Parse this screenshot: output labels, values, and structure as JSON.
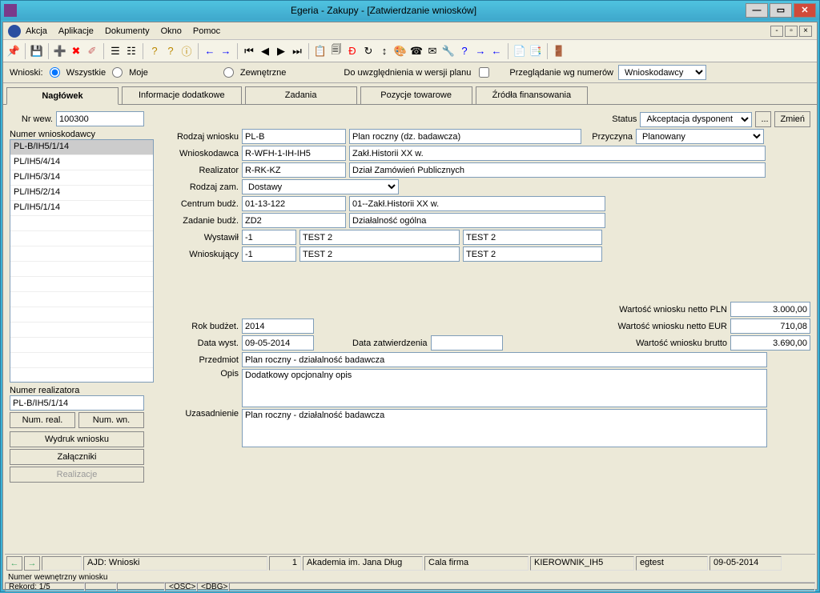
{
  "window": {
    "title": "Egeria - Zakupy - [Zatwierdzanie wniosków]"
  },
  "menu": {
    "m1": "Akcja",
    "m2": "Aplikacje",
    "m3": "Dokumenty",
    "m4": "Okno",
    "m5": "Pomoc"
  },
  "filter": {
    "label": "Wnioski:",
    "r1": "Wszystkie",
    "r2": "Moje",
    "r3": "Zewnętrzne",
    "chk": "Do uwzględnienia w wersji planu",
    "lbl2": "Przeglądanie wg numerów",
    "sel": "Wnioskodawcy"
  },
  "tabs": {
    "t1": "Nagłówek",
    "t2": "Informacje dodatkowe",
    "t3": "Zadania",
    "t4": "Pozycje towarowe",
    "t5": "Źródła finansowania"
  },
  "left": {
    "nr_label": "Nr wew.",
    "nr_val": "100300",
    "list1_label": "Numer wnioskodawcy",
    "list1": [
      "PL-B/IH5/1/14",
      "PL/IH5/4/14",
      "PL/IH5/3/14",
      "PL/IH5/2/14",
      "PL/IH5/1/14"
    ],
    "list2_label": "Numer realizatora",
    "list2_val": "PL-B/IH5/1/14",
    "b1": "Num. real.",
    "b2": "Num. wn.",
    "b3": "Wydruk wniosku",
    "b4": "Załączniki",
    "b5": "Realizacje"
  },
  "form": {
    "status_lbl": "Status",
    "status_val": "Akceptacja dysponent",
    "zmien": "Zmień",
    "dots": "...",
    "rodzajw_lbl": "Rodzaj wniosku",
    "rodzajw_code": "PL-B",
    "rodzajw_desc": "Plan roczny (dz. badawcza)",
    "przyczyna_lbl": "Przyczyna",
    "przyczyna_val": "Planowany",
    "wniosk_lbl": "Wnioskodawca",
    "wniosk_code": "R-WFH-1-IH-IH5",
    "wniosk_desc": "Zakł.Historii XX w.",
    "realiz_lbl": "Realizator",
    "realiz_code": "R-RK-KZ",
    "realiz_desc": "Dział Zamówień Publicznych",
    "rodzajz_lbl": "Rodzaj zam.",
    "rodzajz_val": "Dostawy",
    "centrum_lbl": "Centrum budż.",
    "centrum_code": "01-13-122",
    "centrum_desc": "01--Zakł.Historii XX w.",
    "zadanie_lbl": "Zadanie budż.",
    "zadanie_code": "ZD2",
    "zadanie_desc": "Działalność ogólna",
    "wystawil_lbl": "Wystawił",
    "wystawil_code": "-1",
    "wystawil_d1": "TEST 2",
    "wystawil_d2": "TEST 2",
    "wnioskuj_lbl": "Wnioskujący",
    "wnioskuj_code": "-1",
    "wnioskuj_d1": "TEST 2",
    "wnioskuj_d2": "TEST 2",
    "wart1_lbl": "Wartość wniosku netto PLN",
    "wart1_val": "3.000,00",
    "wart2_lbl": "Wartość wniosku netto EUR",
    "wart2_val": "710,08",
    "wart3_lbl": "Wartość wniosku brutto",
    "wart3_val": "3.690,00",
    "rok_lbl": "Rok budżet.",
    "rok_val": "2014",
    "datawyst_lbl": "Data wyst.",
    "datawyst_val": "09-05-2014",
    "datazatw_lbl": "Data zatwierdzenia",
    "datazatw_val": "",
    "przedmiot_lbl": "Przedmiot",
    "przedmiot_val": "Plan roczny - działalność badawcza",
    "opis_lbl": "Opis",
    "opis_val": "Dodatkowy opcjonalny opis",
    "uzas_lbl": "Uzasadnienie",
    "uzas_val": "Plan roczny - działalność badawcza"
  },
  "status": {
    "s1": "AJD: Wnioski",
    "s2": "1",
    "s3": "Akademia im. Jana Dług",
    "s4": "Cala firma",
    "s5": "KIEROWNIK_IH5",
    "s6": "egtest",
    "s7": "09-05-2014",
    "hint": "Numer wewnętrzny wniosku",
    "rec": "Rekord: 1/5",
    "osc": "<OSC>",
    "dbg": "<DBG>"
  }
}
